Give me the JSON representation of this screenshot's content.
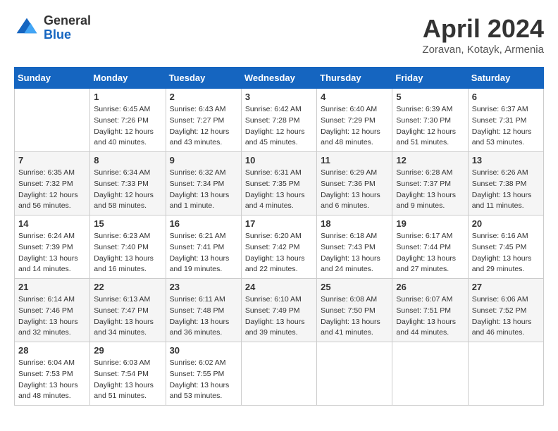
{
  "header": {
    "logo_general": "General",
    "logo_blue": "Blue",
    "month_title": "April 2024",
    "location": "Zoravan, Kotayk, Armenia"
  },
  "days_of_week": [
    "Sunday",
    "Monday",
    "Tuesday",
    "Wednesday",
    "Thursday",
    "Friday",
    "Saturday"
  ],
  "weeks": [
    [
      {
        "day": "",
        "sunrise": "",
        "sunset": "",
        "daylight": ""
      },
      {
        "day": "1",
        "sunrise": "Sunrise: 6:45 AM",
        "sunset": "Sunset: 7:26 PM",
        "daylight": "Daylight: 12 hours and 40 minutes."
      },
      {
        "day": "2",
        "sunrise": "Sunrise: 6:43 AM",
        "sunset": "Sunset: 7:27 PM",
        "daylight": "Daylight: 12 hours and 43 minutes."
      },
      {
        "day": "3",
        "sunrise": "Sunrise: 6:42 AM",
        "sunset": "Sunset: 7:28 PM",
        "daylight": "Daylight: 12 hours and 45 minutes."
      },
      {
        "day": "4",
        "sunrise": "Sunrise: 6:40 AM",
        "sunset": "Sunset: 7:29 PM",
        "daylight": "Daylight: 12 hours and 48 minutes."
      },
      {
        "day": "5",
        "sunrise": "Sunrise: 6:39 AM",
        "sunset": "Sunset: 7:30 PM",
        "daylight": "Daylight: 12 hours and 51 minutes."
      },
      {
        "day": "6",
        "sunrise": "Sunrise: 6:37 AM",
        "sunset": "Sunset: 7:31 PM",
        "daylight": "Daylight: 12 hours and 53 minutes."
      }
    ],
    [
      {
        "day": "7",
        "sunrise": "Sunrise: 6:35 AM",
        "sunset": "Sunset: 7:32 PM",
        "daylight": "Daylight: 12 hours and 56 minutes."
      },
      {
        "day": "8",
        "sunrise": "Sunrise: 6:34 AM",
        "sunset": "Sunset: 7:33 PM",
        "daylight": "Daylight: 12 hours and 58 minutes."
      },
      {
        "day": "9",
        "sunrise": "Sunrise: 6:32 AM",
        "sunset": "Sunset: 7:34 PM",
        "daylight": "Daylight: 13 hours and 1 minute."
      },
      {
        "day": "10",
        "sunrise": "Sunrise: 6:31 AM",
        "sunset": "Sunset: 7:35 PM",
        "daylight": "Daylight: 13 hours and 4 minutes."
      },
      {
        "day": "11",
        "sunrise": "Sunrise: 6:29 AM",
        "sunset": "Sunset: 7:36 PM",
        "daylight": "Daylight: 13 hours and 6 minutes."
      },
      {
        "day": "12",
        "sunrise": "Sunrise: 6:28 AM",
        "sunset": "Sunset: 7:37 PM",
        "daylight": "Daylight: 13 hours and 9 minutes."
      },
      {
        "day": "13",
        "sunrise": "Sunrise: 6:26 AM",
        "sunset": "Sunset: 7:38 PM",
        "daylight": "Daylight: 13 hours and 11 minutes."
      }
    ],
    [
      {
        "day": "14",
        "sunrise": "Sunrise: 6:24 AM",
        "sunset": "Sunset: 7:39 PM",
        "daylight": "Daylight: 13 hours and 14 minutes."
      },
      {
        "day": "15",
        "sunrise": "Sunrise: 6:23 AM",
        "sunset": "Sunset: 7:40 PM",
        "daylight": "Daylight: 13 hours and 16 minutes."
      },
      {
        "day": "16",
        "sunrise": "Sunrise: 6:21 AM",
        "sunset": "Sunset: 7:41 PM",
        "daylight": "Daylight: 13 hours and 19 minutes."
      },
      {
        "day": "17",
        "sunrise": "Sunrise: 6:20 AM",
        "sunset": "Sunset: 7:42 PM",
        "daylight": "Daylight: 13 hours and 22 minutes."
      },
      {
        "day": "18",
        "sunrise": "Sunrise: 6:18 AM",
        "sunset": "Sunset: 7:43 PM",
        "daylight": "Daylight: 13 hours and 24 minutes."
      },
      {
        "day": "19",
        "sunrise": "Sunrise: 6:17 AM",
        "sunset": "Sunset: 7:44 PM",
        "daylight": "Daylight: 13 hours and 27 minutes."
      },
      {
        "day": "20",
        "sunrise": "Sunrise: 6:16 AM",
        "sunset": "Sunset: 7:45 PM",
        "daylight": "Daylight: 13 hours and 29 minutes."
      }
    ],
    [
      {
        "day": "21",
        "sunrise": "Sunrise: 6:14 AM",
        "sunset": "Sunset: 7:46 PM",
        "daylight": "Daylight: 13 hours and 32 minutes."
      },
      {
        "day": "22",
        "sunrise": "Sunrise: 6:13 AM",
        "sunset": "Sunset: 7:47 PM",
        "daylight": "Daylight: 13 hours and 34 minutes."
      },
      {
        "day": "23",
        "sunrise": "Sunrise: 6:11 AM",
        "sunset": "Sunset: 7:48 PM",
        "daylight": "Daylight: 13 hours and 36 minutes."
      },
      {
        "day": "24",
        "sunrise": "Sunrise: 6:10 AM",
        "sunset": "Sunset: 7:49 PM",
        "daylight": "Daylight: 13 hours and 39 minutes."
      },
      {
        "day": "25",
        "sunrise": "Sunrise: 6:08 AM",
        "sunset": "Sunset: 7:50 PM",
        "daylight": "Daylight: 13 hours and 41 minutes."
      },
      {
        "day": "26",
        "sunrise": "Sunrise: 6:07 AM",
        "sunset": "Sunset: 7:51 PM",
        "daylight": "Daylight: 13 hours and 44 minutes."
      },
      {
        "day": "27",
        "sunrise": "Sunrise: 6:06 AM",
        "sunset": "Sunset: 7:52 PM",
        "daylight": "Daylight: 13 hours and 46 minutes."
      }
    ],
    [
      {
        "day": "28",
        "sunrise": "Sunrise: 6:04 AM",
        "sunset": "Sunset: 7:53 PM",
        "daylight": "Daylight: 13 hours and 48 minutes."
      },
      {
        "day": "29",
        "sunrise": "Sunrise: 6:03 AM",
        "sunset": "Sunset: 7:54 PM",
        "daylight": "Daylight: 13 hours and 51 minutes."
      },
      {
        "day": "30",
        "sunrise": "Sunrise: 6:02 AM",
        "sunset": "Sunset: 7:55 PM",
        "daylight": "Daylight: 13 hours and 53 minutes."
      },
      {
        "day": "",
        "sunrise": "",
        "sunset": "",
        "daylight": ""
      },
      {
        "day": "",
        "sunrise": "",
        "sunset": "",
        "daylight": ""
      },
      {
        "day": "",
        "sunrise": "",
        "sunset": "",
        "daylight": ""
      },
      {
        "day": "",
        "sunrise": "",
        "sunset": "",
        "daylight": ""
      }
    ]
  ]
}
